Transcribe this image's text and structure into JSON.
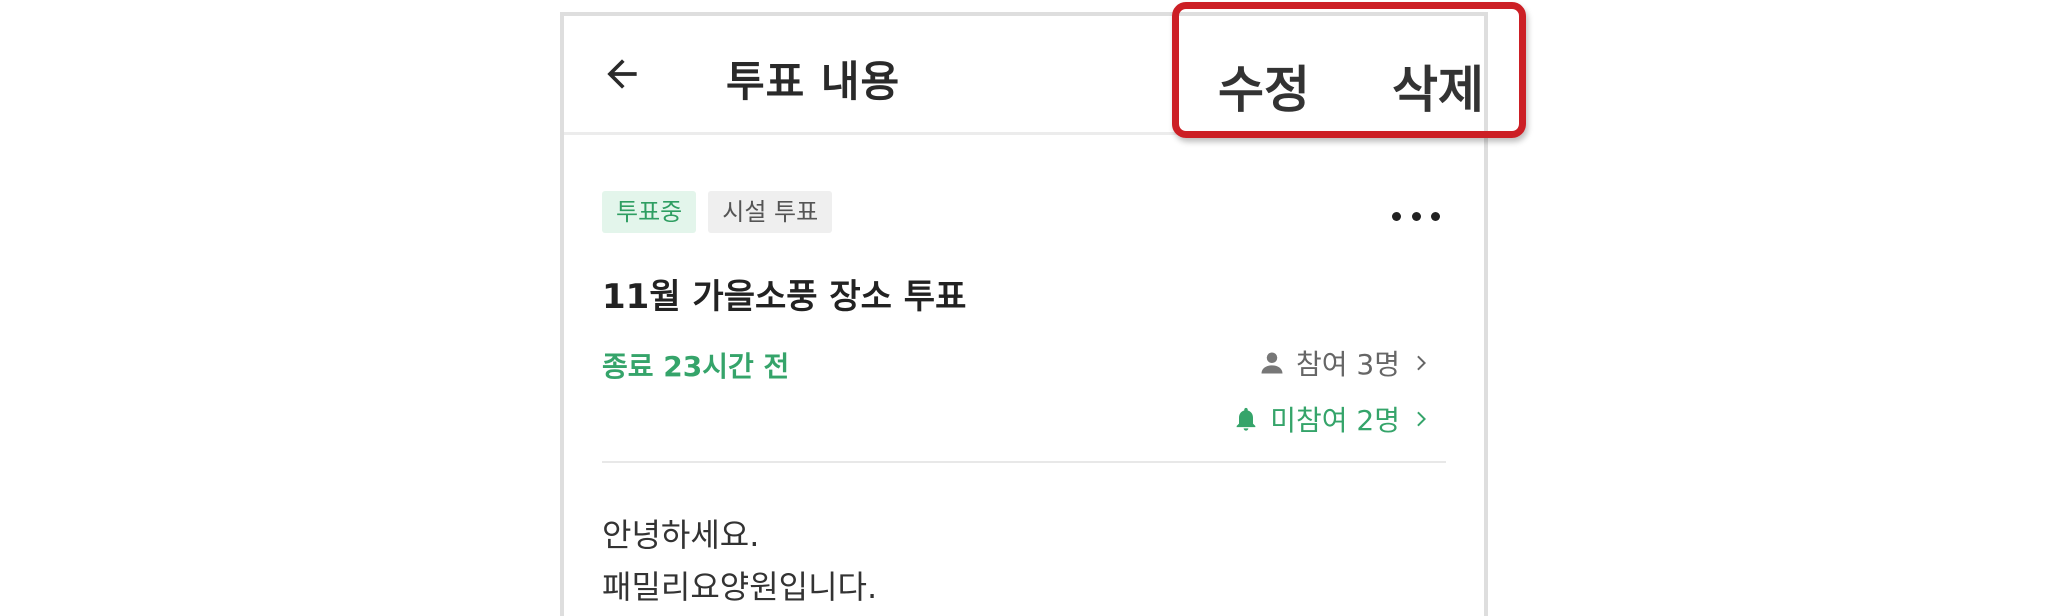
{
  "header": {
    "title": "투표 내용",
    "edit_label": "수정",
    "delete_label": "삭제",
    "back_icon": "arrow-left-icon"
  },
  "poll": {
    "status_badge": "투표중",
    "type_badge": "시설 투표",
    "title": "11월 가을소풍 장소 투표",
    "deadline": "종료 23시간 전",
    "participants": "참여 3명",
    "nonparticipants": "미참여 2명",
    "body_line1": "안녕하세요.",
    "body_line2": "패밀리요양원입니다."
  },
  "colors": {
    "accent_green": "#35a46a",
    "highlight_red": "#cc1f25"
  }
}
